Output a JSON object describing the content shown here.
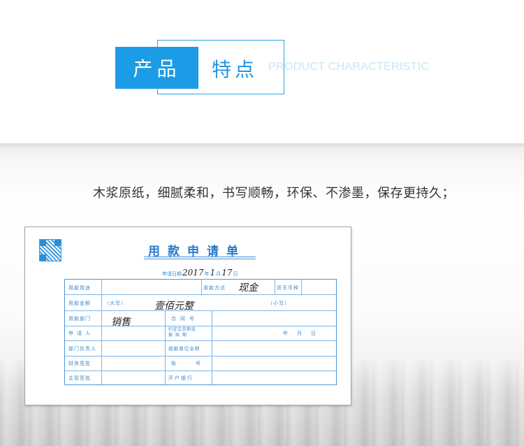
{
  "header": {
    "box_label": "产品",
    "title": "特点",
    "subtitle": "PRODUCT CHARACTERISTIC"
  },
  "caption": "木浆原纸，细腻柔和，书写顺畅，环保、不渗墨，保存更持久；",
  "form": {
    "title": "用款申请单",
    "date_label": "申请日期",
    "date_year": "2017",
    "year_label": "年",
    "date_month": "1",
    "month_label": "月",
    "date_day": "17",
    "day_label": "日",
    "fields": {
      "usage": "用款用途",
      "payment_method": "用款方式",
      "payment_method_value": "现金",
      "currency": "货币币种",
      "amount": "用款金额",
      "amount_upper": "（大写）",
      "amount_upper_value": "壹佰元整",
      "amount_lower": "（小写）",
      "department": "用款部门",
      "department_value": "销售",
      "contract_no": "合同号",
      "applicant": "申请人",
      "agreed_date_1": "约定交货期或",
      "agreed_date_2": "报账期",
      "date_ymd": "年　月　日",
      "dept_head": "部门负责人",
      "payee": "收款单位全称",
      "finance": "财务签批",
      "account": "账号",
      "manager": "主管签批",
      "bank": "开户银行"
    }
  },
  "colors": {
    "accent": "#1c9be6",
    "form_blue": "#3b8ad0"
  }
}
